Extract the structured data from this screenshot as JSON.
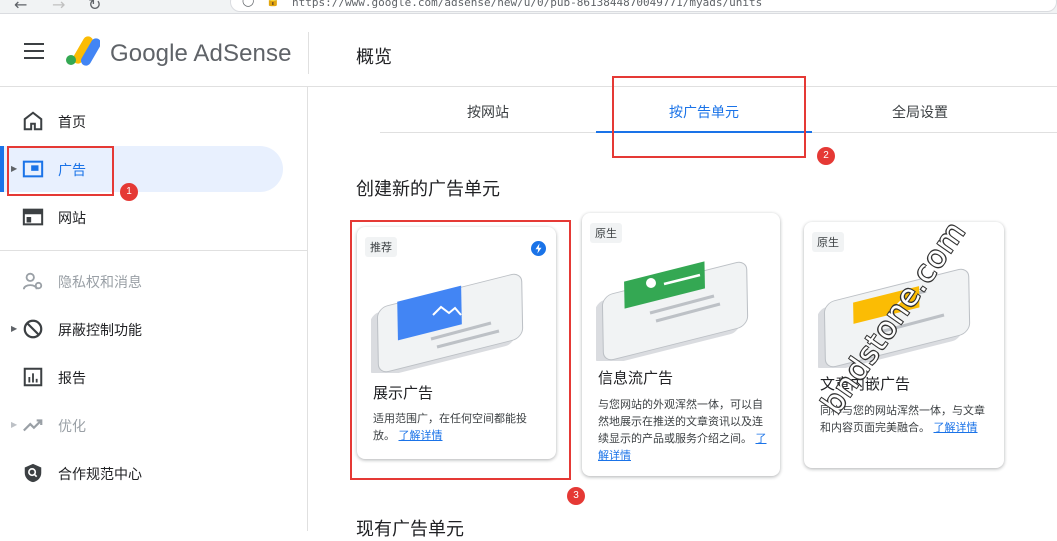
{
  "browser": {
    "url": "https://www.google.com/adsense/new/u/0/pub-8613844870049771/myads/units"
  },
  "header": {
    "brand": "Google AdSense",
    "page_title": "概览"
  },
  "sidebar": {
    "items": [
      {
        "label": "首页",
        "icon": "home-icon"
      },
      {
        "label": "广告",
        "icon": "ads-icon"
      },
      {
        "label": "网站",
        "icon": "sites-icon"
      },
      {
        "label": "隐私权和消息",
        "icon": "privacy-icon"
      },
      {
        "label": "屏蔽控制功能",
        "icon": "block-icon"
      },
      {
        "label": "报告",
        "icon": "reports-icon"
      },
      {
        "label": "优化",
        "icon": "optimize-icon"
      },
      {
        "label": "合作规范中心",
        "icon": "policy-icon"
      }
    ]
  },
  "tabs": [
    {
      "label": "按网站"
    },
    {
      "label": "按广告单元"
    },
    {
      "label": "全局设置"
    }
  ],
  "main": {
    "section_title": "创建新的广告单元",
    "section_title_2": "现有广告单元"
  },
  "cards": [
    {
      "badge": "推荐",
      "title": "展示广告",
      "desc": "适用范围广，在任何空间都能投放。",
      "link": "了解详情"
    },
    {
      "badge": "原生",
      "title": "信息流广告",
      "desc": "与您网站的外观浑然一体，可以自然地展示在推送的文章资讯以及连续显示的产品或服务介绍之间。",
      "link": "了解详情"
    },
    {
      "badge": "原生",
      "title": "文章内嵌广告",
      "desc": "同样与您的网站浑然一体，与文章和内容页面完美融合。",
      "link": "了解详情"
    }
  ],
  "annotations": {
    "m1": "1",
    "m2": "2",
    "m3": "3"
  },
  "watermark": "bndstone.com",
  "colors": {
    "accent": "#1a73e8",
    "annotation": "#e53935"
  }
}
